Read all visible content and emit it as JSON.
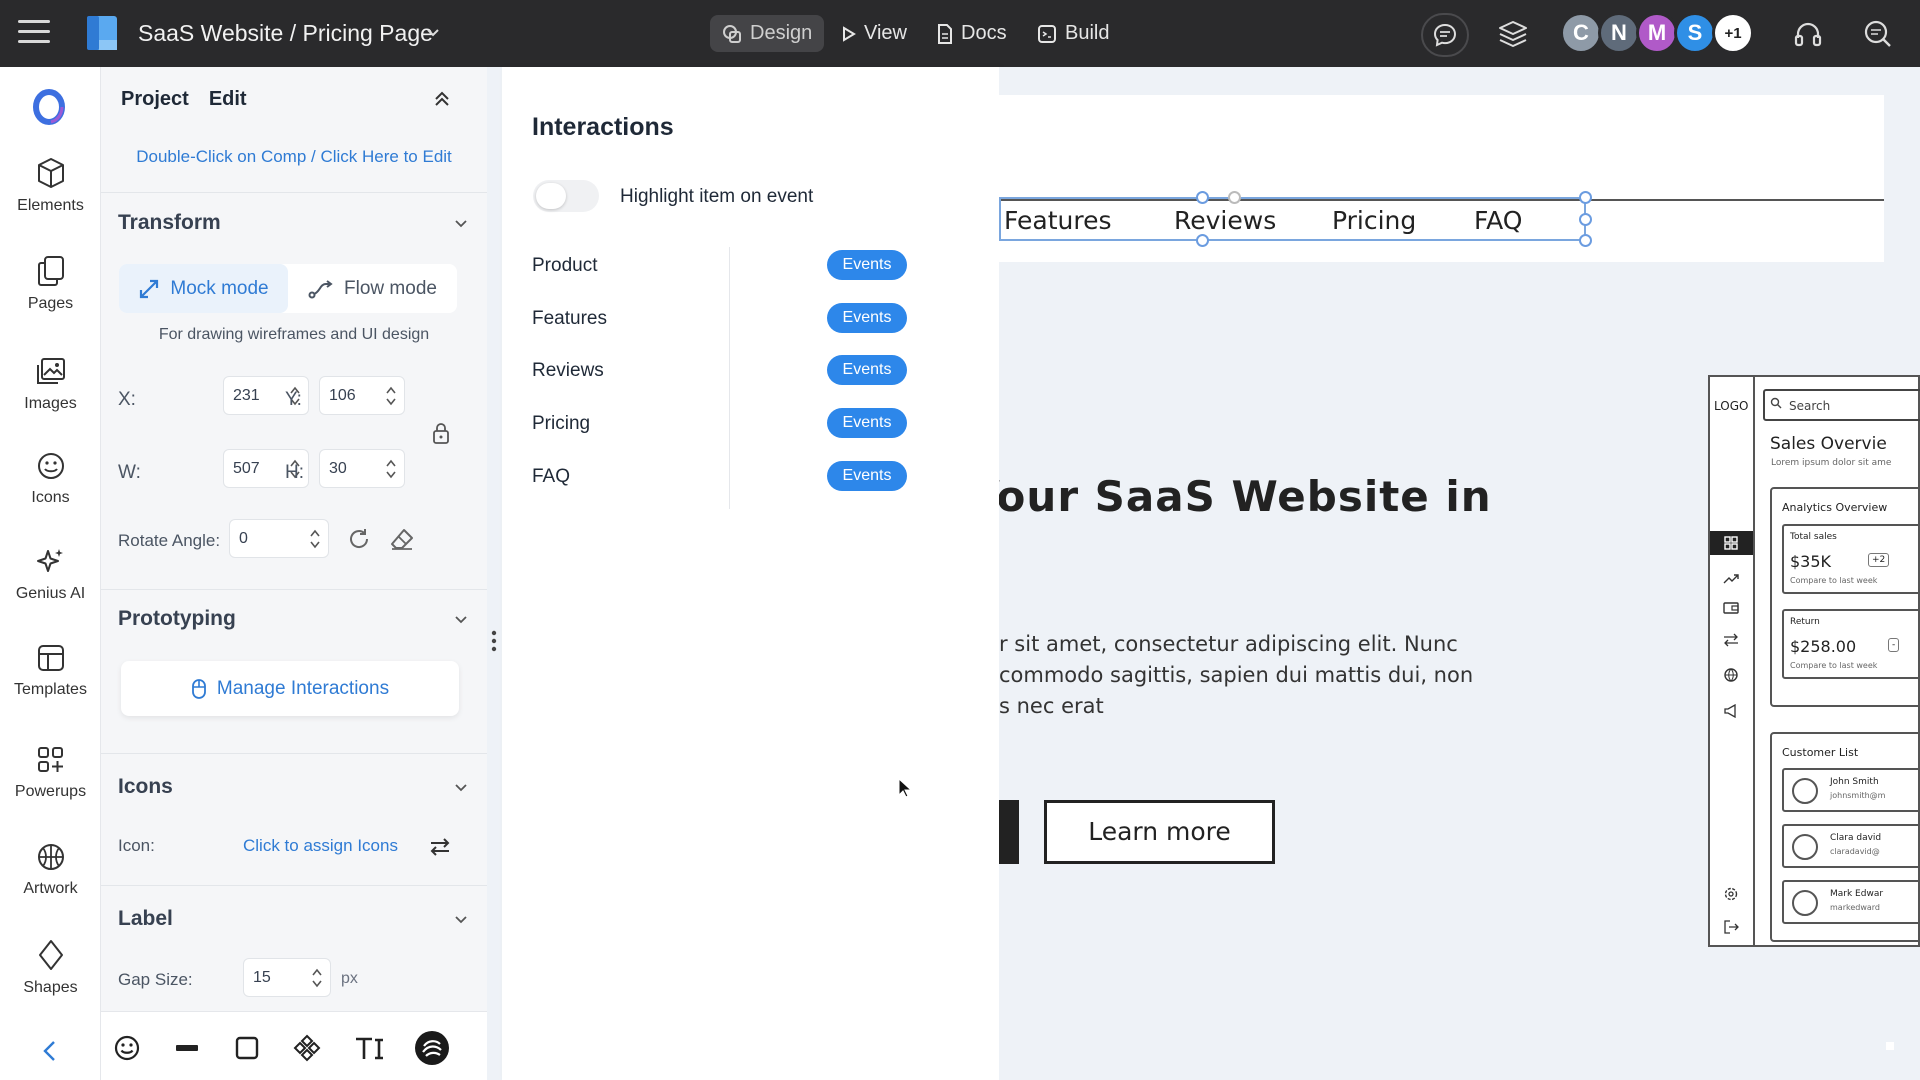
{
  "topbar": {
    "doc_title": "SaaS Website / Pricing Page",
    "modes": {
      "design": "Design",
      "view": "View",
      "docs": "Docs",
      "build": "Build"
    },
    "collaborators": [
      {
        "initial": "C",
        "color": "#8e9aa7"
      },
      {
        "initial": "N",
        "color": "#5f6b7a"
      },
      {
        "initial": "M",
        "color": "#b05ac8"
      },
      {
        "initial": "S",
        "color": "#2f8fe6"
      },
      {
        "initial": "+1",
        "color": "#ffffff"
      }
    ]
  },
  "rail": {
    "items": [
      "Elements",
      "Pages",
      "Images",
      "Icons",
      "Genius AI",
      "Templates",
      "Powerups",
      "Artwork",
      "Shapes"
    ]
  },
  "panel": {
    "tabs": [
      "Project",
      "Edit"
    ],
    "edit_hint": "Double-Click on Comp / Click Here to Edit",
    "transform": {
      "title": "Transform",
      "mock_mode": "Mock mode",
      "flow_mode": "Flow mode",
      "hint": "For drawing wireframes and UI design",
      "x_label": "X:",
      "x": "231",
      "y_label": "Y:",
      "y": "106",
      "w_label": "W:",
      "w": "507",
      "h_label": "H:",
      "h": "30",
      "rotate_label": "Rotate Angle:",
      "rotate": "0"
    },
    "prototyping": {
      "title": "Prototyping",
      "manage": "Manage Interactions"
    },
    "icons": {
      "title": "Icons",
      "icon_label": "Icon:",
      "assign": "Click to assign Icons"
    },
    "label": {
      "title": "Label",
      "gap_label": "Gap Size:",
      "gap": "15",
      "unit": "px"
    }
  },
  "interactions": {
    "title": "Interactions",
    "toggle_label": "Highlight item on event",
    "toggle_on": false,
    "rows": [
      {
        "name": "Product",
        "action": "Events"
      },
      {
        "name": "Features",
        "action": "Events"
      },
      {
        "name": "Reviews",
        "action": "Events"
      },
      {
        "name": "Pricing",
        "action": "Events"
      },
      {
        "name": "FAQ",
        "action": "Events"
      }
    ]
  },
  "canvas": {
    "nav": [
      "Features",
      "Reviews",
      "Pricing",
      "FAQ"
    ],
    "headline": "Your SaaS Website in",
    "body": [
      "r sit amet, consectetur adipiscing elit. Nunc",
      "commodo sagittis, sapien dui mattis dui, non",
      "s nec erat"
    ],
    "learn_more": "Learn more",
    "dashboard": {
      "logo": "LOGO",
      "search": "Search",
      "title": "Sales Overvie",
      "subtitle": "Lorem ipsum dolor sit ame",
      "analytics_title": "Analytics Overview",
      "kpis": [
        {
          "title": "Total sales",
          "value": "$35K",
          "badge": "+2",
          "caption": "Compare to last week"
        },
        {
          "title": "Return",
          "value": "$258.00",
          "badge": "-",
          "caption": "Compare to last week"
        }
      ],
      "customers_title": "Customer List",
      "customers": [
        {
          "name": "John Smith",
          "email": "johnsmith@m"
        },
        {
          "name": "Clara david",
          "email": "claradavid@"
        },
        {
          "name": "Mark Edwar",
          "email": "markedward"
        }
      ]
    }
  },
  "colors": {
    "accent": "#2f7bd4",
    "events_button": "#2d87ea",
    "topbar": "#2a2a2c",
    "selection": "#7aa6de"
  }
}
